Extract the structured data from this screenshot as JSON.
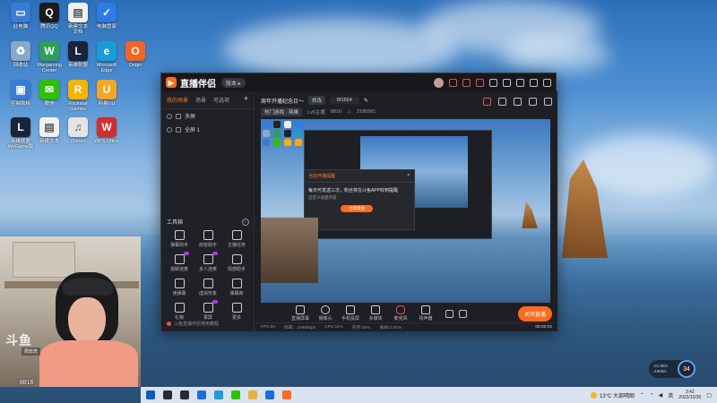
{
  "desktop": {
    "icons": [
      {
        "label": "此电脑",
        "color": "#3a7bd5",
        "glyph": "▭"
      },
      {
        "label": "腾讯QQ",
        "color": "#1b1b1b",
        "glyph": "Q"
      },
      {
        "label": "新建文本\n文档",
        "color": "#f0f0f0",
        "glyph": "▤"
      },
      {
        "label": "电脑管家",
        "color": "#2d7be5",
        "glyph": "✓"
      },
      {
        "label": "回收站",
        "color": "#8aa8c8",
        "glyph": "♻"
      },
      {
        "label": "Wargaming\nCenter",
        "color": "#2f9e5a",
        "glyph": "W"
      },
      {
        "label": "英雄联盟",
        "color": "#1a2438",
        "glyph": "L"
      },
      {
        "label": "Microsoft\nEdge",
        "color": "#1c9bd6",
        "glyph": "e"
      },
      {
        "label": "Origin",
        "color": "#f26522",
        "glyph": "O"
      },
      {
        "label": "控制面板",
        "color": "#3a7bd5",
        "glyph": "▣"
      },
      {
        "label": "微信",
        "color": "#2dc100",
        "glyph": "✉"
      },
      {
        "label": "Rockstar\nGames",
        "color": "#f4b400",
        "glyph": "R"
      },
      {
        "label": "网易UU",
        "color": "#f5a623",
        "glyph": "U"
      },
      {
        "label": "英雄联盟\nWeGame版",
        "color": "#1a2438",
        "glyph": "L"
      },
      {
        "label": "新建文本",
        "color": "#f0f0f0",
        "glyph": "▤"
      },
      {
        "label": "iTunes",
        "color": "#e4e4e4",
        "glyph": "♫"
      },
      {
        "label": "WPS Office",
        "color": "#d22d2d",
        "glyph": "W"
      }
    ]
  },
  "app": {
    "name": "直播伴侣",
    "version_pill": "版本 ▸",
    "left_tabs": [
      "我的场景",
      "场景",
      "可选项"
    ],
    "left_tab_add": "+",
    "sources": [
      "多屏",
      "全屏 1"
    ],
    "tools_title": "工具箱",
    "tools_more": "···",
    "tools": [
      "弹幕助手",
      "房管助手",
      "主播任务",
      "视频连麦",
      "多人连麦",
      "情感助手",
      "读弹幕",
      "虚拟形象",
      "弹幕库",
      "礼物",
      "录屏",
      "更多"
    ],
    "left_footer": "斗鱼直播伴侣使用教程",
    "room_title": "周年开播纪念日～",
    "edit_pill": "修改",
    "room_id": "M1664",
    "category_pill": "热门游戏 · 英雄",
    "hot_label": "Lv5主播",
    "fans": "8816",
    "heat": "2186561",
    "preview_dialog_title": "当前开播提醒",
    "preview_dialog_close": "✕",
    "preview_dialog_msg": "每天可发送三次，粉丝将在斗鱼APP收到提醒",
    "preview_dialog_sub": "自定义提醒内容",
    "preview_dialog_btn": "立即发送",
    "controls": [
      "直播屏幕",
      "摄像头",
      "手机投屏",
      "多媒体",
      "麦克风",
      "扬声器"
    ],
    "go_live": "关闭直播",
    "status": [
      "FPS:60",
      "码率：1985kbps",
      "CPU:11%",
      "内存:45%",
      "丢帧:0.00%"
    ],
    "timer": "00:00:02"
  },
  "webcam": {
    "logo": "斗鱼",
    "room_number": "8816",
    "tag": "周年庆"
  },
  "netmeter": {
    "up": "↑41.5k/s",
    "down": "↓165k/s",
    "percent": "34"
  },
  "taskbar": {
    "weather": "13°C  大部晴朗",
    "time": "3:42",
    "date": "2022/10/30",
    "tray_text": "英",
    "apps": [
      {
        "name": "start",
        "color": "#0b5cb8"
      },
      {
        "name": "search",
        "color": "#2a2a2a"
      },
      {
        "name": "taskview",
        "color": "#2a2a2a"
      },
      {
        "name": "widgets",
        "color": "#1b6fd6"
      },
      {
        "name": "edge",
        "color": "#1c9bd6"
      },
      {
        "name": "wechat",
        "color": "#2dc100"
      },
      {
        "name": "explorer",
        "color": "#e8b33b"
      },
      {
        "name": "store",
        "color": "#1b6fd6"
      },
      {
        "name": "live-companion",
        "color": "#ff6a1f"
      }
    ]
  }
}
